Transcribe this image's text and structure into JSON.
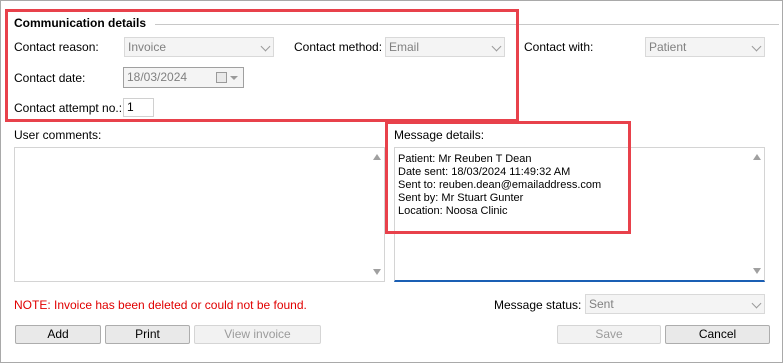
{
  "comm": {
    "title": "Communication details",
    "contact_reason_label": "Contact reason:",
    "contact_reason_value": "Invoice",
    "contact_method_label": "Contact method:",
    "contact_method_value": "Email",
    "contact_with_label": "Contact with:",
    "contact_with_value": "Patient",
    "contact_date_label": "Contact date:",
    "contact_date_value": "18/03/2024",
    "attempt_label": "Contact attempt no.:",
    "attempt_value": "1"
  },
  "comments": {
    "label": "User comments:"
  },
  "message": {
    "label": "Message details:",
    "lines": [
      "Patient: Mr Reuben T Dean",
      "Date sent: 18/03/2024 11:49:32 AM",
      "Sent to: reuben.dean@emailaddress.com",
      "Sent by: Mr Stuart Gunter",
      "Location: Noosa Clinic"
    ]
  },
  "note": "NOTE: Invoice has been deleted or could not be found.",
  "status": {
    "label": "Message status:",
    "value": "Sent"
  },
  "buttons": {
    "add": "Add",
    "print": "Print",
    "view_invoice": "View invoice",
    "save": "Save",
    "cancel": "Cancel"
  },
  "colors": {
    "highlight": "#e8414b",
    "note": "#e00000",
    "focus_underline": "#1a5fb4"
  }
}
